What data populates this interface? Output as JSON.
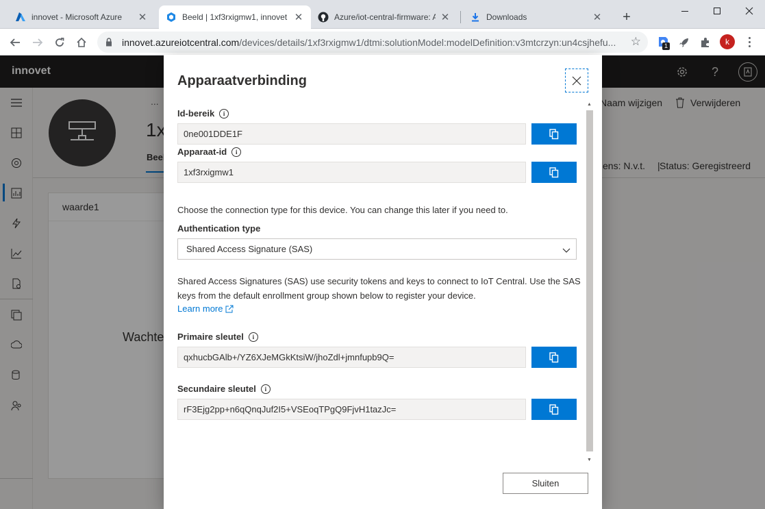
{
  "browser": {
    "tabs": [
      {
        "title": "innovet - Microsoft Azure",
        "active": false
      },
      {
        "title": "Beeld | 1xf3rxigmw1, innovet",
        "active": true
      },
      {
        "title": "Azure/iot-central-firmware: A",
        "active": false
      },
      {
        "title": "Downloads",
        "active": false
      }
    ],
    "new_tab": "+",
    "url_host": "innovet.azureiotcentral.com",
    "url_path": "/devices/details/1xf3rxigmw1/dtmi:solutionModel:modelDefinition:v3mtcrzyn:un4csjhefu...",
    "extension_badge": "1",
    "profile_initial": "k"
  },
  "app": {
    "brand": "innovet",
    "device_title": "1x",
    "breadcrumb": "...",
    "tab_label": "Beeld",
    "commands": {
      "rename": "Naam wijzigen",
      "delete": "Verwijderen"
    },
    "status": {
      "org_fragment": "ens: N.v.t.",
      "separator": "|",
      "status_text": "Status: Geregistreerd"
    },
    "tile_title": "waarde1",
    "tile_message": "Wachte"
  },
  "dialog": {
    "title": "Apparaatverbinding",
    "id_scope": {
      "label": "Id-bereik",
      "value": "0ne001DDE1F"
    },
    "device_id": {
      "label": "Apparaat-id",
      "value": "1xf3rxigmw1"
    },
    "connection_intro": "Choose the connection type for this device. You can change this later if you need to.",
    "auth": {
      "label": "Authentication type",
      "selected": "Shared Access Signature (SAS)"
    },
    "sas_description": "Shared Access Signatures (SAS) use security tokens and keys to connect to IoT Central. Use the SAS keys from the default enrollment group shown below to register your device.",
    "learn_more": "Learn more",
    "primary_key": {
      "label": "Primaire sleutel",
      "value": "qxhucbGAlb+/YZ6XJeMGkKtsiW/jhoZdl+jmnfupb9Q="
    },
    "secondary_key": {
      "label": "Secundaire sleutel",
      "value": "rF3Ejg2pp+n6qQnqJuf2I5+VSEoqTPgQ9FjvH1tazJc="
    },
    "close_label": "Sluiten"
  },
  "colors": {
    "accent": "#0078d4",
    "header": "#201f1e",
    "overlay": "rgba(0,0,0,0.40)"
  }
}
